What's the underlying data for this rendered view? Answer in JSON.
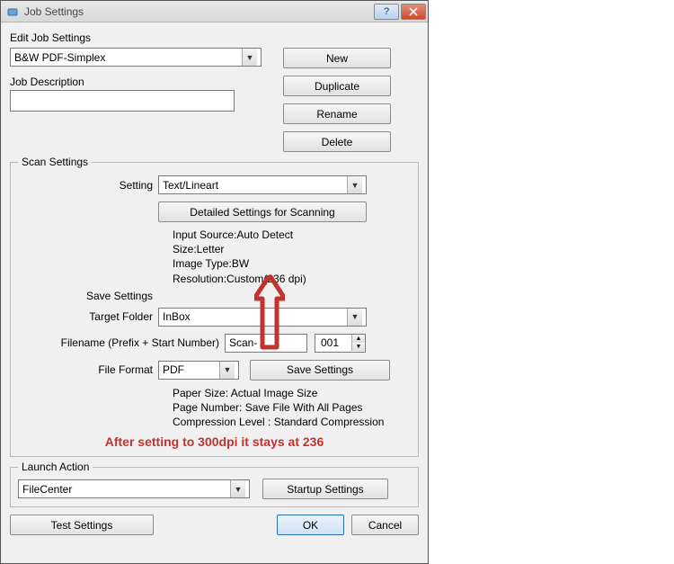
{
  "title": "Job Settings",
  "edit_label": "Edit Job Settings",
  "job_select": "B&W PDF-Simplex",
  "desc_label": "Job Description",
  "desc_value": "",
  "buttons": {
    "new": "New",
    "duplicate": "Duplicate",
    "rename": "Rename",
    "delete": "Delete"
  },
  "scan": {
    "legend": "Scan Settings",
    "setting_label": "Setting",
    "setting_value": "Text/Lineart",
    "detailed_btn": "Detailed Settings for Scanning",
    "info": {
      "input_source": "Input Source:Auto Detect",
      "size": "Size:Letter",
      "image_type": "Image Type:BW",
      "resolution": "Resolution:Custom(236 dpi)"
    },
    "save_label": "Save Settings",
    "target_folder_label": "Target Folder",
    "target_folder_value": "InBox",
    "filename_label": "Filename (Prefix + Start Number)",
    "prefix_value": "Scan-",
    "number_value": "001",
    "file_format_label": "File Format",
    "file_format_value": "PDF",
    "save_settings_btn": "Save Settings",
    "info2": {
      "paper": "Paper Size: Actual Image Size",
      "page": "Page Number: Save File With All Pages",
      "comp": "Compression Level : Standard Compression"
    }
  },
  "launch": {
    "legend": "Launch Action",
    "value": "FileCenter",
    "startup_btn": "Startup Settings"
  },
  "footer": {
    "test": "Test Settings",
    "ok": "OK",
    "cancel": "Cancel"
  },
  "annotation": "After setting to 300dpi it stays at 236"
}
